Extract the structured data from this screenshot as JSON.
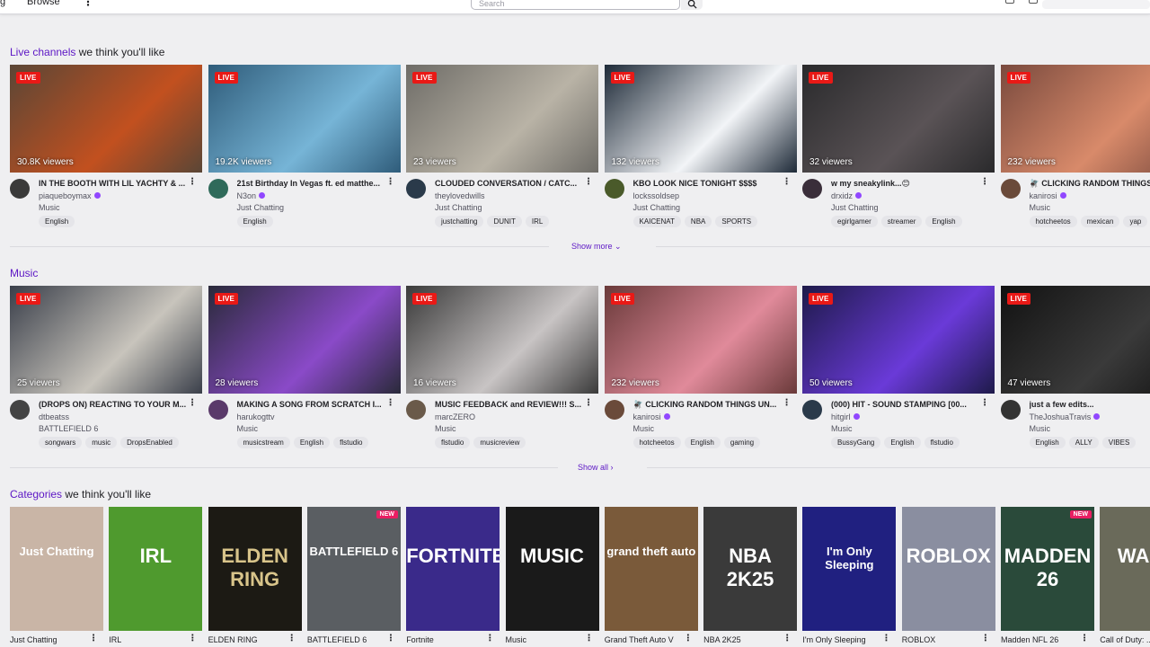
{
  "header": {
    "cut_text": "g",
    "browse_label": "Browse",
    "more_label": "⋮",
    "search_placeholder": "Search"
  },
  "live_section": {
    "title_accent": "Live channels",
    "title_rest": " we think you'll like",
    "show_more_label": "Show more",
    "cards": [
      {
        "viewers": "30.8K viewers",
        "title": "IN THE BOOTH WITH LIL YACHTY & ...",
        "channel": "piaqueboymax",
        "verified": true,
        "game": "Music",
        "tags": [
          "English"
        ],
        "colors": [
          "#5a4636",
          "#c2501f"
        ],
        "avatar": "#3a3a3a"
      },
      {
        "viewers": "19.2K viewers",
        "title": "21st Birthday In Vegas ft. ed matthe...",
        "channel": "N3on",
        "verified": true,
        "game": "Just Chatting",
        "tags": [
          "English"
        ],
        "colors": [
          "#2f5c7a",
          "#76b4d6"
        ],
        "avatar": "#2f6a5a"
      },
      {
        "viewers": "23 viewers",
        "title": "CLOUDED CONVERSATION / CATC...",
        "channel": "theylovedwills",
        "verified": false,
        "game": "Just Chatting",
        "tags": [
          "justchatting",
          "DUNIT",
          "IRL"
        ],
        "colors": [
          "#6e6c67",
          "#b9b3a6"
        ],
        "avatar": "#2a3a4a"
      },
      {
        "viewers": "132 viewers",
        "title": "KBO LOOK NICE TONIGHT $$$$",
        "channel": "lockssoldsep",
        "verified": false,
        "game": "Just Chatting",
        "tags": [
          "KAICENAT",
          "NBA",
          "SPORTS"
        ],
        "colors": [
          "#1e2a38",
          "#f2f4f7"
        ],
        "avatar": "#4a5a2a"
      },
      {
        "viewers": "32 viewers",
        "title": "w my sneakylink...😊",
        "channel": "drxidz",
        "verified": true,
        "game": "Just Chatting",
        "tags": [
          "egirlgamer",
          "streamer",
          "English"
        ],
        "colors": [
          "#2a2a2c",
          "#5a5356"
        ],
        "avatar": "#3a2e3a"
      },
      {
        "viewers": "232 viewers",
        "title": "🪰 CLICKING RANDOM THINGS UN...",
        "channel": "kanirosi",
        "verified": true,
        "game": "Music",
        "tags": [
          "hotcheetos",
          "mexican",
          "yap"
        ],
        "colors": [
          "#7a4a3e",
          "#d88a6a"
        ],
        "avatar": "#6a4a3a"
      }
    ]
  },
  "music_section": {
    "title_accent": "Music",
    "title_rest": "",
    "show_all_label": "Show all",
    "cards": [
      {
        "viewers": "25 viewers",
        "title": "(DROPS ON) REACTING TO YOUR M...",
        "channel": "dtbeatss",
        "verified": false,
        "game": "BATTLEFIELD 6",
        "tags": [
          "songwars",
          "music",
          "DropsEnabled"
        ],
        "colors": [
          "#3a3f4a",
          "#c8c4bc"
        ],
        "avatar": "#444"
      },
      {
        "viewers": "28 viewers",
        "title": "MAKING A SONG FROM SCRATCH I...",
        "channel": "harukogttv",
        "verified": false,
        "game": "Music",
        "tags": [
          "musicstream",
          "English",
          "flstudio"
        ],
        "colors": [
          "#2a2a3a",
          "#8a4ac8"
        ],
        "avatar": "#5a3a6a"
      },
      {
        "viewers": "16 viewers",
        "title": "MUSIC FEEDBACK and REVIEW!!! S...",
        "channel": "marcZERO",
        "verified": false,
        "game": "Music",
        "tags": [
          "flstudio",
          "musicreview"
        ],
        "colors": [
          "#3a3a3a",
          "#c8c4c4"
        ],
        "avatar": "#6a5a4a"
      },
      {
        "viewers": "232 viewers",
        "title": "🪰 CLICKING RANDOM THINGS UN...",
        "channel": "kanirosi",
        "verified": true,
        "game": "Music",
        "tags": [
          "hotcheetos",
          "English",
          "gaming"
        ],
        "colors": [
          "#6a3a3a",
          "#e08a9a"
        ],
        "avatar": "#6a4a3a"
      },
      {
        "viewers": "50 viewers",
        "title": "(000) HIT - SOUND STAMPING [00...",
        "channel": "hitgirl",
        "verified": true,
        "game": "Music",
        "tags": [
          "BussyGang",
          "English",
          "flstudio"
        ],
        "colors": [
          "#1e1a4a",
          "#6a3ad8"
        ],
        "avatar": "#2a3a4a"
      },
      {
        "viewers": "47 viewers",
        "title": "just a few edits...",
        "channel": "TheJoshuaTravis",
        "verified": true,
        "game": "Music",
        "tags": [
          "English",
          "ALLY",
          "VIBES"
        ],
        "colors": [
          "#121212",
          "#3a3a3a"
        ],
        "avatar": "#333"
      }
    ]
  },
  "categories_section": {
    "title_accent": "Categories",
    "title_rest": " we think you'll like",
    "items": [
      {
        "name": "Just Chatting",
        "art": "Just Chatting",
        "new": false,
        "bg": "#c9b5a6",
        "fg": "#ffffff"
      },
      {
        "name": "IRL",
        "art": "IRL",
        "new": false,
        "bg": "#4f9a2e",
        "fg": "#ffffff"
      },
      {
        "name": "ELDEN RING",
        "art": "ELDEN RING",
        "new": false,
        "bg": "#1c1a14",
        "fg": "#d8c48a"
      },
      {
        "name": "BATTLEFIELD 6",
        "art": "BATTLEFIELD 6",
        "new": true,
        "bg": "#5a5e62",
        "fg": "#ffffff"
      },
      {
        "name": "Fortnite",
        "art": "FORTNITE",
        "new": false,
        "bg": "#3a2a8a",
        "fg": "#ffffff"
      },
      {
        "name": "Music",
        "art": "MUSIC",
        "new": false,
        "bg": "#1a1a1a",
        "fg": "#ffffff"
      },
      {
        "name": "Grand Theft Auto V",
        "art": "grand theft auto",
        "new": false,
        "bg": "#7a5a3a",
        "fg": "#ffffff"
      },
      {
        "name": "NBA 2K25",
        "art": "NBA 2K25",
        "new": false,
        "bg": "#3a3a3a",
        "fg": "#ffffff"
      },
      {
        "name": "I'm Only Sleeping",
        "art": "I'm Only Sleeping",
        "new": false,
        "bg": "#202080",
        "fg": "#ffffff"
      },
      {
        "name": "ROBLOX",
        "art": "ROBLOX",
        "new": false,
        "bg": "#8a8ea0",
        "fg": "#ffffff"
      },
      {
        "name": "Madden NFL 26",
        "art": "MADDEN 26",
        "new": true,
        "bg": "#2a4a3a",
        "fg": "#ffffff"
      },
      {
        "name": "Call of Duty: ...",
        "art": "WARZ",
        "new": false,
        "bg": "#6a6a5a",
        "fg": "#ffffff"
      }
    ]
  },
  "labels": {
    "live": "LIVE",
    "new": "NEW"
  }
}
